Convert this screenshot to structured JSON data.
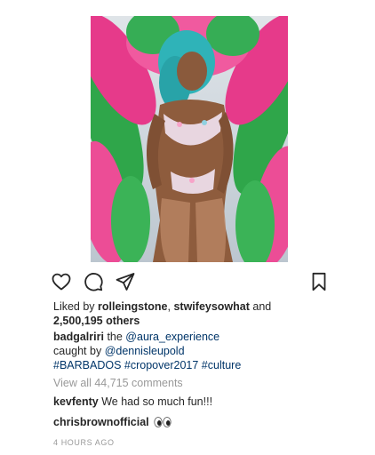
{
  "post": {
    "image_alt": "Carnival costume photo with pink and green feathers",
    "likes": {
      "prefix": "Liked by ",
      "user1": "rolleingstone",
      "sep": ", ",
      "user2": "stwifeysowhat",
      "and": " and",
      "count": "2,500,195 others"
    },
    "caption": {
      "username": "badgalriri",
      "text1": " the ",
      "mention1": "@aura_experience",
      "text2": "caught by ",
      "mention2": "@dennisleupold",
      "tag1": "#BARBADOS",
      "tag2": "#cropover2017",
      "tag3": "#culture"
    },
    "view_all_comments": "View all 44,715 comments",
    "comments": [
      {
        "username": "kevfenty",
        "text": " We had so much fun!!!"
      },
      {
        "username": "chrisbrownofficial",
        "text": " ",
        "emoji": "eyes-emoji"
      }
    ],
    "timestamp": "4 HOURS AGO"
  },
  "icons": {
    "like": "heart-icon",
    "comment": "comment-icon",
    "share": "paper-plane-icon",
    "save": "bookmark-icon"
  },
  "colors": {
    "text": "#262626",
    "link": "#003569",
    "muted": "#999999"
  }
}
